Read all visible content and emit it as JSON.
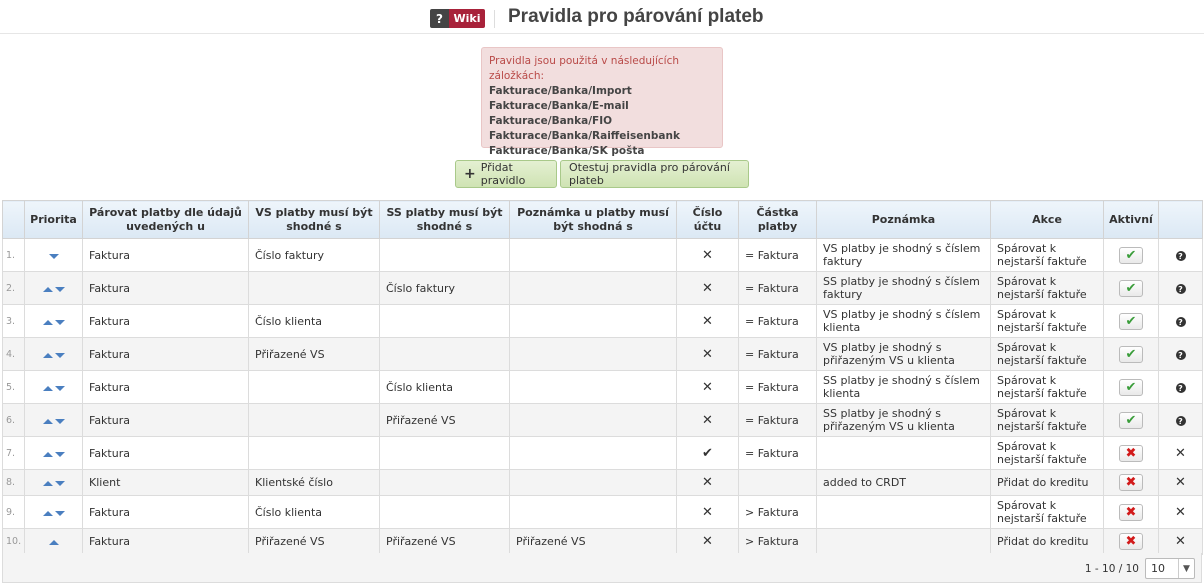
{
  "header": {
    "wiki_q": "?",
    "wiki_label": "Wiki",
    "title": "Pravidla pro párování plateb"
  },
  "notice": {
    "title": "Pravidla jsou použitá v následujících záložkách:",
    "tabs": [
      "Fakturace/Banka/Import",
      "Fakturace/Banka/E-mail",
      "Fakturace/Banka/FIO",
      "Fakturace/Banka/Raiffeisenbank",
      "Fakturace/Banka/SK pošta"
    ]
  },
  "toolbar": {
    "add_label": "Přidat pravidlo",
    "test_label": "Otestuj pravidla pro párování plateb"
  },
  "table": {
    "headers": {
      "priority": "Priorita",
      "pair_by": "Párovat platby dle údajů uvedených u",
      "vs": "VS platby musí být shodné s",
      "ss": "SS platby musí být shodné s",
      "note_match": "Poznámka u platby musí být shodná s",
      "account": "Číslo účtu",
      "amount": "Částka platby",
      "note": "Poznámka",
      "action": "Akce",
      "active": "Aktivní"
    },
    "rows": [
      {
        "num": "1.",
        "arrows": "down",
        "pair_by": "Faktura",
        "vs": "Číslo faktury",
        "ss": "",
        "note_match": "",
        "account": "✕",
        "amount": "= Faktura",
        "note": "VS platby je shodný s číslem faktury",
        "action": "Spárovat k nejstarší faktuře",
        "active": true,
        "last": "help"
      },
      {
        "num": "2.",
        "arrows": "both",
        "pair_by": "Faktura",
        "vs": "",
        "ss": "Číslo faktury",
        "note_match": "",
        "account": "✕",
        "amount": "= Faktura",
        "note": "SS platby je shodný s číslem faktury",
        "action": "Spárovat k nejstarší faktuře",
        "active": true,
        "last": "help"
      },
      {
        "num": "3.",
        "arrows": "both",
        "pair_by": "Faktura",
        "vs": "Číslo klienta",
        "ss": "",
        "note_match": "",
        "account": "✕",
        "amount": "= Faktura",
        "note": "VS platby je shodný s číslem klienta",
        "action": "Spárovat k nejstarší faktuře",
        "active": true,
        "last": "help"
      },
      {
        "num": "4.",
        "arrows": "both",
        "pair_by": "Faktura",
        "vs": "Přiřazené VS",
        "ss": "",
        "note_match": "",
        "account": "✕",
        "amount": "= Faktura",
        "note": "VS platby je shodný s přiřazeným VS u klienta",
        "action": "Spárovat k nejstarší faktuře",
        "active": true,
        "last": "help"
      },
      {
        "num": "5.",
        "arrows": "both",
        "pair_by": "Faktura",
        "vs": "",
        "ss": "Číslo klienta",
        "note_match": "",
        "account": "✕",
        "amount": "= Faktura",
        "note": "SS platby je shodný s číslem klienta",
        "action": "Spárovat k nejstarší faktuře",
        "active": true,
        "last": "help"
      },
      {
        "num": "6.",
        "arrows": "both",
        "pair_by": "Faktura",
        "vs": "",
        "ss": "Přiřazené VS",
        "note_match": "",
        "account": "✕",
        "amount": "= Faktura",
        "note": "SS platby je shodný s přiřazeným VS u klienta",
        "action": "Spárovat k nejstarší faktuře",
        "active": true,
        "last": "help"
      },
      {
        "num": "7.",
        "arrows": "both",
        "pair_by": "Faktura",
        "vs": "",
        "ss": "",
        "note_match": "",
        "account": "✔",
        "amount": "= Faktura",
        "note": "",
        "action": "Spárovat k nejstarší faktuře",
        "active": false,
        "last": "delete"
      },
      {
        "num": "8.",
        "arrows": "both",
        "pair_by": "Klient",
        "vs": "Klientské číslo",
        "ss": "",
        "note_match": "",
        "account": "✕",
        "amount": "",
        "note": "added to CRDT",
        "action": "Přidat do kreditu",
        "active": false,
        "last": "delete",
        "short": true
      },
      {
        "num": "9.",
        "arrows": "both",
        "pair_by": "Faktura",
        "vs": "Číslo klienta",
        "ss": "",
        "note_match": "",
        "account": "✕",
        "amount": "> Faktura",
        "note": "",
        "action": "Spárovat k nejstarší faktuře",
        "active": false,
        "last": "delete"
      },
      {
        "num": "10.",
        "arrows": "up",
        "pair_by": "Faktura",
        "vs": "Přiřazené VS",
        "ss": "Přiřazené VS",
        "note_match": "Přiřazené VS",
        "account": "✕",
        "amount": "> Faktura",
        "note": "",
        "action": "Přidat do kreditu",
        "active": false,
        "last": "delete",
        "short": true
      }
    ]
  },
  "pager": {
    "range": "1 - 10 / 10",
    "page_size": "10"
  },
  "colors": {
    "accent_blue": "#4a7fc0",
    "active_green": "#3a9d3a",
    "inactive_red": "#d21a1a",
    "notice_bg": "#f2dede"
  }
}
